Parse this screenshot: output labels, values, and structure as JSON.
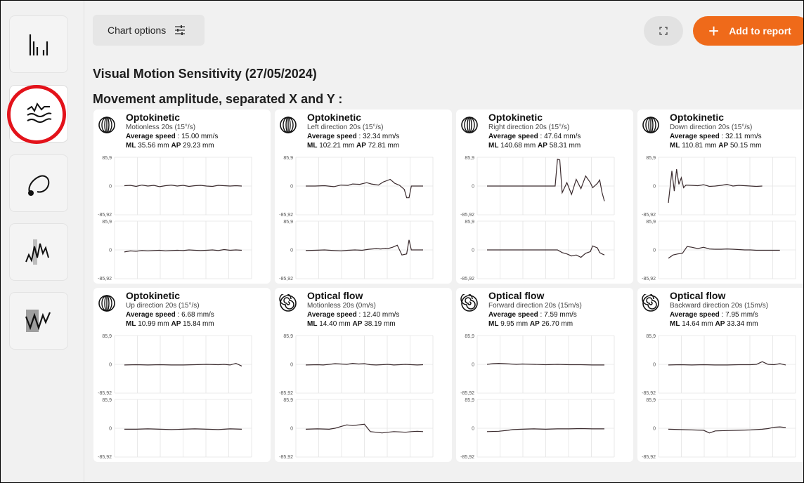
{
  "toolbar": {
    "chart_options_label": "Chart options",
    "add_to_report_label": "Add to report"
  },
  "colors": {
    "accent": "#ef6a1a",
    "highlight_ring": "#e3121a",
    "trace": "#3a2a2d"
  },
  "page_title": "Visual Motion Sensitivity (27/05/2024)",
  "section_title": "Movement amplitude, separated X and Y :",
  "sidebar": [
    {
      "icon": "bar-chart-icon"
    },
    {
      "icon": "waves-icon",
      "active": true
    },
    {
      "icon": "loop-icon"
    },
    {
      "icon": "oscillation-icon"
    },
    {
      "icon": "wave-highlight-icon"
    }
  ],
  "axis": {
    "max_label": "85,9",
    "zero_label": "0",
    "min_label": "-85,92"
  },
  "cards": [
    {
      "icon": "optokinetic-icon",
      "title": "Optokinetic",
      "subtitle": "Motionless 20s (15°/s)",
      "speed_label": "Average speed",
      "speed_value": " : 15.00 mm/s",
      "ml_label": "ML",
      "ml_value": " 35.56 mm ",
      "ap_label": "AP",
      "ap_value": " 29.23 mm"
    },
    {
      "icon": "optokinetic-icon",
      "title": "Optokinetic",
      "subtitle": "Left direction 20s (15°/s)",
      "speed_label": "Average speed",
      "speed_value": " : 32.34 mm/s",
      "ml_label": "ML",
      "ml_value": " 102.21 mm ",
      "ap_label": "AP",
      "ap_value": " 72.81 mm"
    },
    {
      "icon": "optokinetic-icon",
      "title": "Optokinetic",
      "subtitle": "Right direction 20s (15°/s)",
      "speed_label": "Average speed",
      "speed_value": " : 47.64 mm/s",
      "ml_label": "ML",
      "ml_value": " 140.68 mm ",
      "ap_label": "AP",
      "ap_value": " 58.31 mm"
    },
    {
      "icon": "optokinetic-icon",
      "title": "Optokinetic",
      "subtitle": "Down direction 20s (15°/s)",
      "speed_label": "Average speed",
      "speed_value": " : 32.11 mm/s",
      "ml_label": "ML",
      "ml_value": " 110.81 mm ",
      "ap_label": "AP",
      "ap_value": " 50.15 mm"
    },
    {
      "icon": "optokinetic-icon",
      "title": "Optokinetic",
      "subtitle": "Up direction 20s (15°/s)",
      "speed_label": "Average speed",
      "speed_value": " : 6.68 mm/s",
      "ml_label": "ML",
      "ml_value": " 10.99 mm ",
      "ap_label": "AP",
      "ap_value": " 15.84 mm"
    },
    {
      "icon": "optical-flow-icon",
      "title": "Optical flow",
      "subtitle": "Motionless 20s (0m/s)",
      "speed_label": "Average speed",
      "speed_value": " : 12.40 mm/s",
      "ml_label": "ML",
      "ml_value": " 14.40 mm ",
      "ap_label": "AP",
      "ap_value": " 38.19 mm"
    },
    {
      "icon": "optical-flow-icon",
      "title": "Optical flow",
      "subtitle": "Forward direction 20s (15m/s)",
      "speed_label": "Average speed",
      "speed_value": " : 7.59 mm/s",
      "ml_label": "ML",
      "ml_value": " 9.95 mm ",
      "ap_label": "AP",
      "ap_value": " 26.70 mm"
    },
    {
      "icon": "optical-flow-icon",
      "title": "Optical flow",
      "subtitle": "Backward direction 20s (15m/s)",
      "speed_label": "Average speed",
      "speed_value": " : 7.95 mm/s",
      "ml_label": "ML",
      "ml_value": " 14.64 mm ",
      "ap_label": "AP",
      "ap_value": " 33.34 mm"
    }
  ],
  "chart_data": {
    "type": "line",
    "ylim": [
      -85.92,
      85.9
    ],
    "yticks": [
      "85,9",
      "0",
      "-85,92"
    ],
    "grid": true,
    "plots": [
      {
        "x": [
          0,
          5,
          10,
          15,
          20,
          25,
          30,
          35,
          40,
          45,
          50,
          55,
          60,
          65,
          70,
          75,
          80,
          85,
          90,
          95,
          100
        ],
        "y": [
          1,
          2,
          -1,
          3,
          0,
          2,
          -2,
          1,
          3,
          0,
          2,
          -1,
          1,
          2,
          0,
          -1,
          2,
          1,
          0,
          1,
          0
        ]
      },
      {
        "x": [
          0,
          5,
          10,
          15,
          20,
          25,
          30,
          35,
          40,
          45,
          50,
          55,
          60,
          65,
          70,
          75,
          80,
          85,
          90,
          95,
          100
        ],
        "y": [
          -6,
          -3,
          -4,
          -2,
          -3,
          -2,
          -1,
          -3,
          -2,
          -1,
          -2,
          0,
          -1,
          -2,
          -1,
          0,
          -2,
          1,
          -1,
          0,
          -1
        ]
      },
      {
        "x": [
          0,
          8,
          16,
          24,
          30,
          36,
          40,
          46,
          52,
          56,
          62,
          66,
          72,
          76,
          80,
          84,
          86,
          88,
          90,
          94,
          100
        ],
        "y": [
          0,
          0,
          1,
          -2,
          3,
          2,
          6,
          5,
          10,
          6,
          3,
          12,
          20,
          8,
          2,
          -10,
          -35,
          -35,
          0,
          0,
          0
        ]
      },
      {
        "x": [
          0,
          8,
          16,
          24,
          30,
          36,
          42,
          48,
          54,
          60,
          64,
          68,
          70,
          74,
          78,
          82,
          86,
          88,
          90,
          94,
          100
        ],
        "y": [
          -2,
          -1,
          0,
          -2,
          -3,
          -1,
          0,
          -1,
          2,
          4,
          3,
          5,
          4,
          8,
          14,
          -15,
          -12,
          30,
          0,
          0,
          0
        ]
      },
      {
        "x": [
          0,
          10,
          20,
          30,
          40,
          50,
          58,
          60,
          62,
          64,
          68,
          72,
          76,
          80,
          84,
          88,
          90,
          94,
          96,
          98,
          100
        ],
        "y": [
          0,
          0,
          0,
          0,
          0,
          0,
          0,
          80,
          78,
          -20,
          10,
          -25,
          20,
          -8,
          30,
          10,
          -5,
          8,
          18,
          -20,
          -45
        ]
      },
      {
        "x": [
          0,
          10,
          20,
          30,
          40,
          50,
          55,
          58,
          60,
          64,
          68,
          72,
          76,
          80,
          84,
          88,
          90,
          94,
          96,
          98,
          100
        ],
        "y": [
          0,
          0,
          0,
          0,
          0,
          0,
          0,
          0,
          0,
          -8,
          -12,
          -18,
          -15,
          -22,
          -10,
          -5,
          12,
          6,
          -8,
          -12,
          -15
        ]
      },
      {
        "x": [
          0,
          3,
          5,
          7,
          9,
          11,
          13,
          15,
          20,
          25,
          30,
          35,
          40,
          45,
          50,
          55,
          60,
          65,
          70,
          75,
          80
        ],
        "y": [
          -50,
          45,
          -15,
          50,
          5,
          25,
          -5,
          3,
          2,
          1,
          4,
          -1,
          0,
          2,
          5,
          0,
          2,
          1,
          0,
          -1,
          0
        ]
      },
      {
        "x": [
          0,
          4,
          8,
          12,
          16,
          20,
          25,
          30,
          35,
          40,
          45,
          50,
          55,
          60,
          65,
          70,
          75,
          80,
          85,
          90,
          95
        ],
        "y": [
          -25,
          -15,
          -12,
          -10,
          10,
          8,
          4,
          8,
          3,
          2,
          2,
          3,
          2,
          1,
          0,
          0,
          -1,
          -1,
          -1,
          -1,
          -1
        ]
      },
      {
        "x": [
          0,
          10,
          20,
          30,
          40,
          50,
          60,
          70,
          80,
          85,
          90,
          95,
          100
        ],
        "y": [
          -2,
          -1,
          -2,
          -1,
          -2,
          -2,
          -1,
          0,
          -1,
          0,
          -2,
          3,
          -5
        ]
      },
      {
        "x": [
          0,
          10,
          20,
          30,
          40,
          50,
          60,
          70,
          80,
          90,
          100
        ],
        "y": [
          -3,
          -3,
          -2,
          -3,
          -4,
          -3,
          -2,
          -3,
          -4,
          -2,
          -3
        ]
      },
      {
        "x": [
          0,
          10,
          15,
          20,
          25,
          30,
          35,
          40,
          45,
          50,
          55,
          60,
          65,
          70,
          75,
          80,
          85,
          90,
          95,
          100
        ],
        "y": [
          -2,
          -1,
          -2,
          0,
          2,
          1,
          0,
          3,
          1,
          2,
          -1,
          -2,
          -1,
          0,
          -2,
          -1,
          0,
          -1,
          -2,
          -1
        ]
      },
      {
        "x": [
          0,
          10,
          20,
          25,
          30,
          35,
          40,
          45,
          50,
          55,
          60,
          65,
          70,
          75,
          80,
          85,
          90,
          95,
          100
        ],
        "y": [
          -3,
          -2,
          -3,
          0,
          5,
          10,
          8,
          10,
          12,
          -10,
          -12,
          -14,
          -12,
          -10,
          -11,
          -12,
          -10,
          -9,
          -10
        ]
      },
      {
        "x": [
          0,
          5,
          10,
          15,
          20,
          25,
          30,
          40,
          50,
          60,
          70,
          80,
          90,
          100
        ],
        "y": [
          0,
          2,
          3,
          2,
          1,
          0,
          1,
          0,
          -1,
          0,
          -1,
          -1,
          -2,
          -2
        ]
      },
      {
        "x": [
          0,
          10,
          18,
          22,
          30,
          40,
          50,
          60,
          70,
          80,
          90,
          100
        ],
        "y": [
          -10,
          -9,
          -6,
          -4,
          -3,
          -2,
          -3,
          -2,
          -2,
          -1,
          -2,
          -2
        ]
      },
      {
        "x": [
          0,
          10,
          20,
          30,
          40,
          50,
          60,
          70,
          75,
          80,
          85,
          90,
          95,
          100
        ],
        "y": [
          -2,
          -1,
          -2,
          -1,
          -2,
          -2,
          -1,
          -1,
          0,
          8,
          0,
          -1,
          2,
          -2
        ]
      },
      {
        "x": [
          0,
          10,
          20,
          30,
          35,
          40,
          50,
          60,
          70,
          80,
          85,
          90,
          95,
          100
        ],
        "y": [
          -3,
          -4,
          -5,
          -6,
          -14,
          -8,
          -7,
          -6,
          -5,
          -3,
          -1,
          3,
          4,
          2
        ]
      }
    ]
  }
}
